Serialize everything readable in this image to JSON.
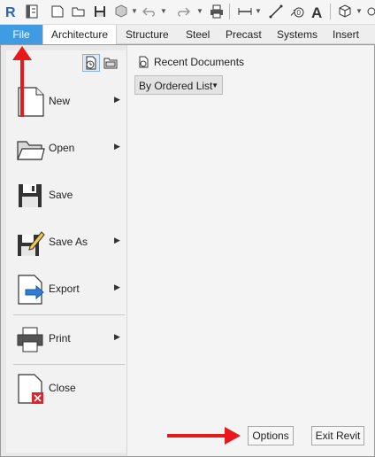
{
  "ribbon": {
    "tabs": [
      "File",
      "Architecture",
      "Structure",
      "Steel",
      "Precast",
      "Systems",
      "Insert"
    ]
  },
  "menu": {
    "items": [
      {
        "label": "New",
        "icon": "new-document-icon",
        "submenu": true
      },
      {
        "label": "Open",
        "icon": "folder-open-icon",
        "submenu": true
      },
      {
        "label": "Save",
        "icon": "floppy-disk-icon",
        "submenu": false
      },
      {
        "label": "Save As",
        "icon": "save-as-icon",
        "submenu": true
      },
      {
        "label": "Export",
        "icon": "export-icon",
        "submenu": true
      },
      {
        "label": "Print",
        "icon": "printer-icon",
        "submenu": true
      },
      {
        "label": "Close",
        "icon": "close-document-icon",
        "submenu": false
      }
    ]
  },
  "recent": {
    "title": "Recent Documents",
    "sort_dropdown": "By Ordered List"
  },
  "footer": {
    "options_label": "Options",
    "exit_label": "Exit Revit"
  },
  "colors": {
    "file_tab": "#3f9be4",
    "annotation_arrow": "#e8191d"
  }
}
